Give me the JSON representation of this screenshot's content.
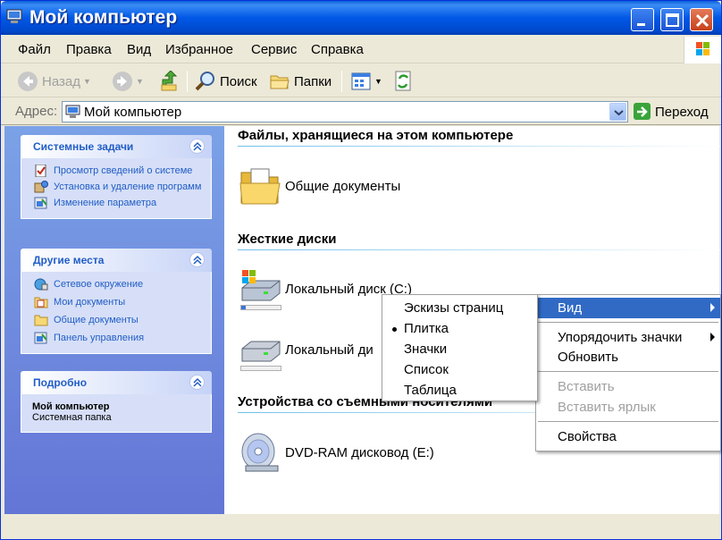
{
  "window": {
    "title": "Мой компьютер"
  },
  "menu": [
    "Файл",
    "Правка",
    "Вид",
    "Избранное",
    "Сервис",
    "Справка"
  ],
  "toolbar": {
    "back": "Назад",
    "search": "Поиск",
    "folders": "Папки"
  },
  "address": {
    "label": "Адрес:",
    "value": "Мой компьютер",
    "go": "Переход"
  },
  "left": {
    "system_tasks": {
      "title": "Системные задачи",
      "items": [
        "Просмотр сведений о системе",
        "Установка и удаление программ",
        "Изменение параметра"
      ]
    },
    "other_places": {
      "title": "Другие места",
      "items": [
        "Сетевое окружение",
        "Мои документы",
        "Общие документы",
        "Панель управления"
      ]
    },
    "details": {
      "title": "Подробно",
      "name": "Мой компьютер",
      "type": "Системная папка"
    }
  },
  "groups": {
    "files": {
      "title": "Файлы, хранящиеся на этом компьютере",
      "items": [
        "Общие документы"
      ]
    },
    "hdd": {
      "title": "Жесткие диски",
      "items": [
        "Локальный диск (C:)",
        "Локальный ди"
      ]
    },
    "removable": {
      "title": "Устройства со съемными носителями",
      "items": [
        "DVD-RAM дисковод (E:)"
      ]
    }
  },
  "disk_usage": [
    0.12,
    0.0
  ],
  "context_menu": {
    "items": [
      "Вид",
      "Упорядочить значки",
      "Обновить",
      "Вставить",
      "Вставить ярлык",
      "Свойства"
    ]
  },
  "view_submenu": {
    "items": [
      "Эскизы страниц",
      "Плитка",
      "Значки",
      "Список",
      "Таблица"
    ],
    "selected": "Плитка"
  },
  "colors": {
    "titlebar": "#0058e6",
    "highlight": "#316ac5",
    "link": "#215dc6"
  }
}
